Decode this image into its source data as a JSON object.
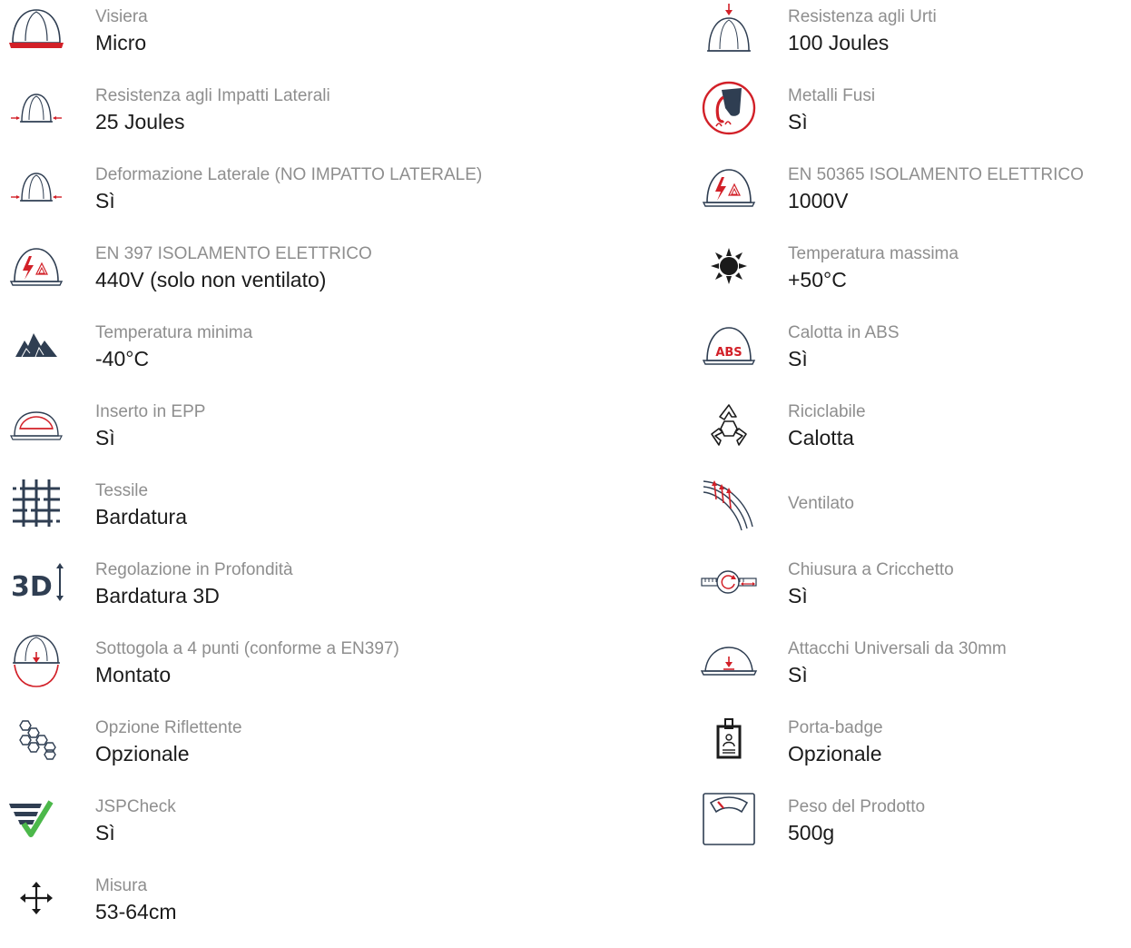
{
  "colors": {
    "navy": "#2f3e52",
    "red": "#d22028",
    "green": "#4cb84a",
    "label": "#8e8e8e",
    "value": "#1b1b1b"
  },
  "left": [
    {
      "icon": "helmet-visor-icon",
      "label": "Visiera",
      "value": "Micro"
    },
    {
      "icon": "helmet-lateral-impact-icon",
      "label": "Resistenza agli Impatti Laterali",
      "value": "25 Joules"
    },
    {
      "icon": "helmet-lateral-deformation-icon",
      "label": "Deformazione Laterale (NO IMPATTO LATERALE)",
      "value": "Sì"
    },
    {
      "icon": "helmet-electrical-insulation-icon",
      "label": "EN 397 ISOLAMENTO ELETTRICO",
      "value": "440V (solo non ventilato)"
    },
    {
      "icon": "mountains-icon",
      "label": "Temperatura minima",
      "value": "-40°C"
    },
    {
      "icon": "helmet-epp-insert-icon",
      "label": "Inserto in EPP",
      "value": "Sì"
    },
    {
      "icon": "textile-weave-icon",
      "label": "Tessile",
      "value": "Bardatura"
    },
    {
      "icon": "3d-depth-icon",
      "label": "Regolazione in Profondità",
      "value": "Bardatura 3D"
    },
    {
      "icon": "helmet-chinstrap-icon",
      "label": "Sottogola a 4 punti (conforme a EN397)",
      "value": "Montato"
    },
    {
      "icon": "reflective-hexagons-icon",
      "label": "Opzione Riflettente",
      "value": "Opzionale"
    },
    {
      "icon": "jspcheck-icon",
      "label": "JSPCheck",
      "value": "Sì"
    },
    {
      "icon": "size-arrows-icon",
      "label": "Misura",
      "value": "53-64cm"
    }
  ],
  "right": [
    {
      "icon": "helmet-impact-icon",
      "label": "Resistenza agli Urti",
      "value": "100 Joules"
    },
    {
      "icon": "molten-metal-icon",
      "label": "Metalli Fusi",
      "value": "Sì"
    },
    {
      "icon": "helmet-electrical-insulation-icon",
      "label": "EN 50365 ISOLAMENTO ELETTRICO",
      "value": "1000V"
    },
    {
      "icon": "sun-icon",
      "label": "Temperatura massima",
      "value": "+50°C"
    },
    {
      "icon": "helmet-abs-icon",
      "label": "Calotta in ABS",
      "value": "Sì",
      "icon_text": "ABS"
    },
    {
      "icon": "recycle-icon",
      "label": "Riciclabile",
      "value": "Calotta"
    },
    {
      "icon": "ventilation-icon",
      "label": "Ventilato",
      "value": ""
    },
    {
      "icon": "ratchet-icon",
      "label": "Chiusura a Cricchetto",
      "value": "Sì"
    },
    {
      "icon": "helmet-slot-icon",
      "label": "Attacchi Universali da 30mm",
      "value": "Sì"
    },
    {
      "icon": "badge-holder-icon",
      "label": "Porta-badge",
      "value": "Opzionale"
    },
    {
      "icon": "scale-icon",
      "label": "Peso del Prodotto",
      "value": "500g"
    }
  ]
}
